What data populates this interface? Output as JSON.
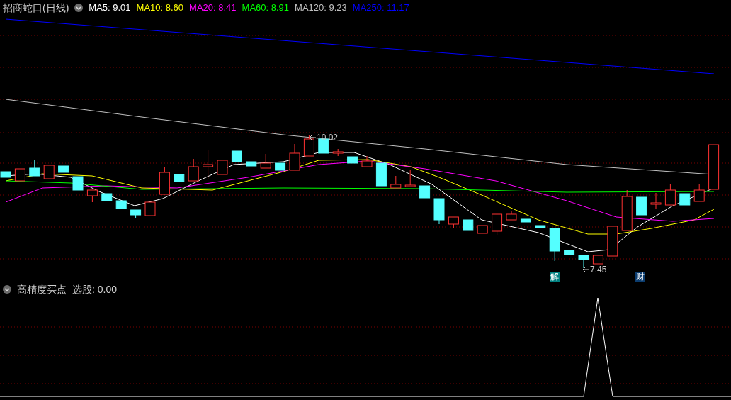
{
  "chart": {
    "title": "招商蛇口(日线)",
    "moving_averages": [
      {
        "label": "MA5: 9.01",
        "color": "#ffffff"
      },
      {
        "label": "MA10: 8.60",
        "color": "#ffff00"
      },
      {
        "label": "MA20: 8.41",
        "color": "#ff00ff"
      },
      {
        "label": "MA60: 8.91",
        "color": "#00ff00"
      },
      {
        "label": "MA120: 9.23",
        "color": "#c0c0c0"
      },
      {
        "label": "MA250: 11.17",
        "color": "#0000ff"
      }
    ],
    "price_labels": [
      {
        "kind": "high",
        "text": "10.02"
      },
      {
        "kind": "low",
        "text": "7.45"
      }
    ],
    "event_markers": [
      {
        "text": "解",
        "color": "#008080"
      },
      {
        "text": "财",
        "color": "#0b3c6e"
      }
    ]
  },
  "indicator": {
    "title": "高精度买点",
    "reading": "选股: 0.00"
  }
}
